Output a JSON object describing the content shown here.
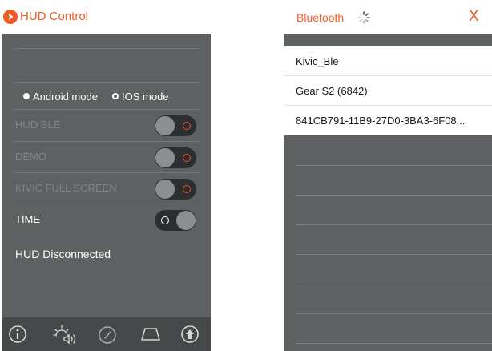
{
  "hud_control": {
    "title": "HUD Control",
    "modes": [
      {
        "label": "Android mode",
        "selected": false
      },
      {
        "label": "IOS mode",
        "selected": true
      }
    ],
    "settings": [
      {
        "label": "HUD BLE",
        "on": false
      },
      {
        "label": "DEMO",
        "on": false
      },
      {
        "label": "KIVIC FULL SCREEN",
        "on": false
      },
      {
        "label": "TIME",
        "on": true
      }
    ],
    "status": "HUD Disconnected",
    "tabs": [
      "info-icon",
      "brightness-sound-icon",
      "speedometer-icon",
      "trapezoid-icon",
      "upload-icon"
    ]
  },
  "bluetooth": {
    "title": "Bluetooth",
    "close_label": "X",
    "devices": [
      "Kivic_Ble",
      "Gear S2 (6842)",
      "841CB791-11B9-27D0-3BA3-6F08..."
    ]
  },
  "colors": {
    "accent": "#f15a24",
    "panel": "#5d6161",
    "tabbar": "#454949",
    "toggle_track": "#2c2f30",
    "toggle_off_indicator": "#f0492a"
  }
}
